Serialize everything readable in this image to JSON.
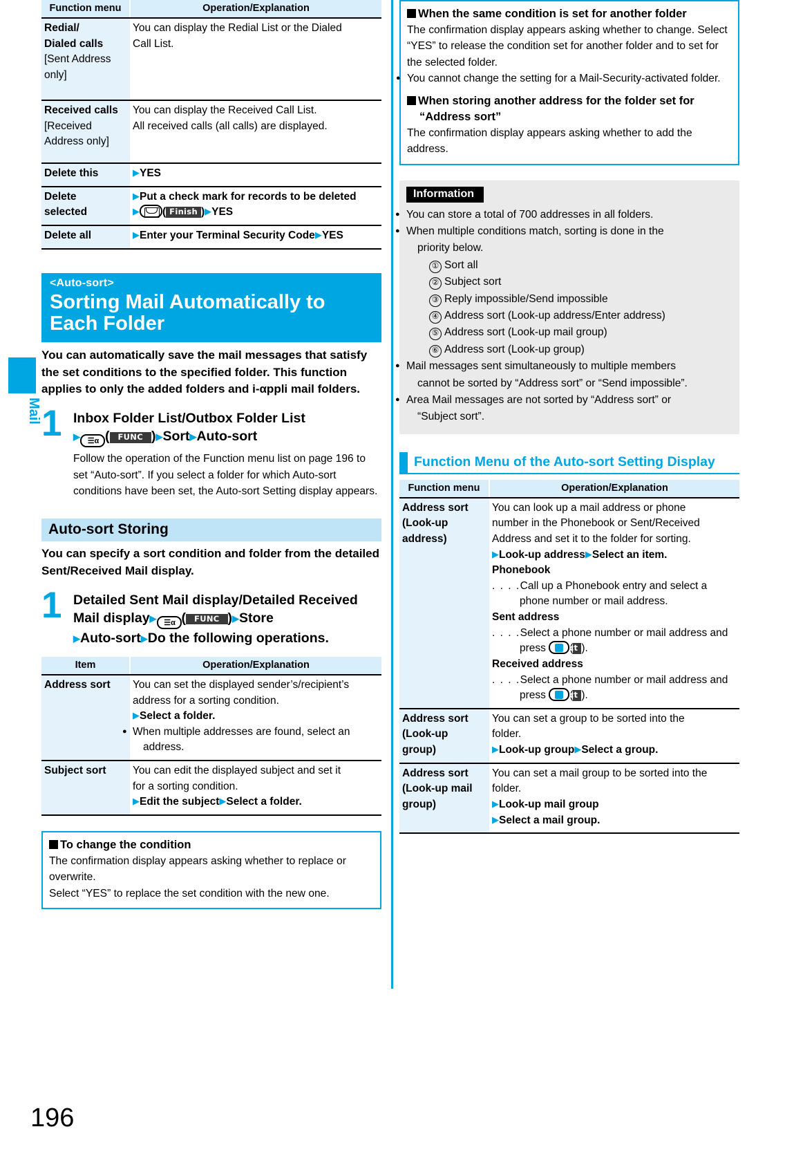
{
  "page": {
    "number": "196",
    "side_tab": "Mail"
  },
  "colors": {
    "accent": "#00a6e2",
    "band": "#bfe4f7",
    "cell": "#e4f2fb",
    "header": "#d9eefb",
    "info_bg": "#eaeaea"
  },
  "left": {
    "table1": {
      "headers": [
        "Function menu",
        "Operation/Explanation"
      ],
      "rows": [
        {
          "item_lines": [
            "Redial/",
            "Dialed calls",
            "[Sent Address",
            "only]"
          ],
          "item_bold_count": 2,
          "body": [
            "You can display the Redial List or the Dialed",
            "Call List."
          ]
        },
        {
          "item_lines": [
            "Received calls",
            "[Received",
            "Address only]"
          ],
          "item_bold_count": 1,
          "body": [
            "You can display the Received Call List.",
            "All received calls (all calls) are displayed."
          ]
        },
        {
          "item_lines": [
            "Delete this"
          ],
          "item_bold_count": 1,
          "body_op": "YES"
        },
        {
          "item_lines": [
            "Delete",
            "selected"
          ],
          "item_bold_count": 2,
          "body_op1": "Put a check mark for records to be deleted",
          "body_op2_key": "mail-key",
          "body_op2_soft": "Finish",
          "body_op2_tail": "YES"
        },
        {
          "item_lines": [
            "Delete all"
          ],
          "item_bold_count": 1,
          "body_op1": "Enter your Terminal Security Code",
          "body_op2_tail": "YES"
        }
      ]
    },
    "chapter": {
      "subtitle": "<Auto-sort>",
      "title_line1": "Sorting Mail Automatically to",
      "title_line2": "Each Folder"
    },
    "intro": "You can automatically save the mail messages that satisfy the set conditions to the specified folder. This function applies to only the added folders and i-αppli mail folders.",
    "step1": {
      "number": "1",
      "head_line1": "Inbox Folder List/Outbox Folder List",
      "head_key_label": "FUNC",
      "head_line2_a": "Sort",
      "head_line2_b": "Auto-sort",
      "body": "Follow the operation of the Function menu list on page 196 to set “Auto-sort”. If you select a folder for which Auto-sort conditions have been set, the Auto-sort Setting display appears."
    },
    "band": "Auto-sort Storing",
    "band_text": "You can specify a sort condition and folder from the detailed Sent/Received Mail display.",
    "step2": {
      "number": "1",
      "head_line1": "Detailed Sent Mail display/Detailed Received",
      "head_line2_a": "Mail display",
      "head_key_label": "FUNC",
      "head_line2_b": "Store",
      "head_line3_a": "Auto-sort",
      "head_line3_b": "Do the following operations."
    },
    "table2": {
      "headers": [
        "Item",
        "Operation/Explanation"
      ],
      "rows": [
        {
          "item": "Address sort",
          "body_lines": [
            "You can set the displayed sender’s/recipient’s",
            "address for a sorting condition."
          ],
          "op": "Select a folder.",
          "bullet": "When multiple addresses are found, select an address."
        },
        {
          "item": "Subject sort",
          "body_lines": [
            "You can edit the displayed subject and set it",
            "for a sorting condition."
          ],
          "op1": "Edit the subject",
          "op2": "Select a folder."
        }
      ]
    },
    "notebox": {
      "heading": "To change the condition",
      "lines": [
        "The confirmation display appears asking whether to replace or overwrite.",
        "Select “YES” to replace the set condition with the new one."
      ]
    }
  },
  "right": {
    "notebox": {
      "heading1": "When the same condition is set for another folder",
      "para1": "The confirmation display appears asking whether to change. Select “YES” to release the condition set for another folder and to set for the selected folder.",
      "bullet1": "You cannot change the setting for a Mail-Security-activated folder.",
      "heading2_a": "When storing another address for the folder set for",
      "heading2_b": "“Address sort”",
      "para2": "The confirmation display appears asking whether to add the address."
    },
    "information": {
      "tag": "Information",
      "items": [
        {
          "type": "bullet",
          "text": "You can store a total of 700 addresses in all folders."
        },
        {
          "type": "bullet",
          "text": "When multiple conditions match, sorting is done in the"
        },
        {
          "type": "cont",
          "text": "priority below."
        },
        {
          "type": "num",
          "n": "①",
          "text": "Sort all"
        },
        {
          "type": "num",
          "n": "②",
          "text": "Subject sort"
        },
        {
          "type": "num",
          "n": "③",
          "text": "Reply impossible/Send impossible"
        },
        {
          "type": "num",
          "n": "④",
          "text": "Address sort (Look-up address/Enter address)"
        },
        {
          "type": "num",
          "n": "⑤",
          "text": "Address sort (Look-up mail group)"
        },
        {
          "type": "num",
          "n": "⑥",
          "text": "Address sort (Look-up group)"
        },
        {
          "type": "bullet",
          "text": "Mail messages sent simultaneously to multiple members"
        },
        {
          "type": "cont",
          "text": "cannot be sorted by “Address sort” or “Send impossible”."
        },
        {
          "type": "bullet",
          "text": "Area Mail messages are not sorted by “Address sort” or"
        },
        {
          "type": "cont",
          "text": "“Subject sort”."
        }
      ]
    },
    "section_title": "Function Menu of the Auto-sort Setting Display",
    "table": {
      "headers": [
        "Function menu",
        "Operation/Explanation"
      ],
      "rows": [
        {
          "item_lines": [
            "Address sort",
            "(Look-up",
            "address)"
          ],
          "body_lines": [
            "You can look up a mail address or phone",
            "number in the Phonebook or Sent/Received",
            "Address and set it to the folder for sorting."
          ],
          "op1": "Look-up address",
          "op2": "Select an item.",
          "sub": [
            {
              "label": "Phonebook",
              "dots": ". . . .",
              "text": "Call up a Phonebook entry and select a phone number or mail address."
            },
            {
              "label": "Sent address",
              "dots": ". . . .",
              "text": "Select a phone number or mail address and press",
              "key": "ok-key",
              "soft": "Select",
              "tail": ")."
            },
            {
              "label": "Received address",
              "dots": ". . . .",
              "text": "Select a phone number or mail address and press",
              "key": "ok-key",
              "soft": "Select",
              "tail": ")."
            }
          ]
        },
        {
          "item_lines": [
            "Address sort",
            "(Look-up",
            "group)"
          ],
          "body_lines": [
            "You can set a group to be sorted into the",
            "folder."
          ],
          "op1": "Look-up group",
          "op2": "Select a group."
        },
        {
          "item_lines": [
            "Address sort",
            "(Look-up mail",
            "group)"
          ],
          "body_lines": [
            "You can set a mail group to be sorted into the",
            "folder."
          ],
          "op1": "Look-up mail group",
          "op2": "Select a mail group."
        }
      ]
    }
  }
}
